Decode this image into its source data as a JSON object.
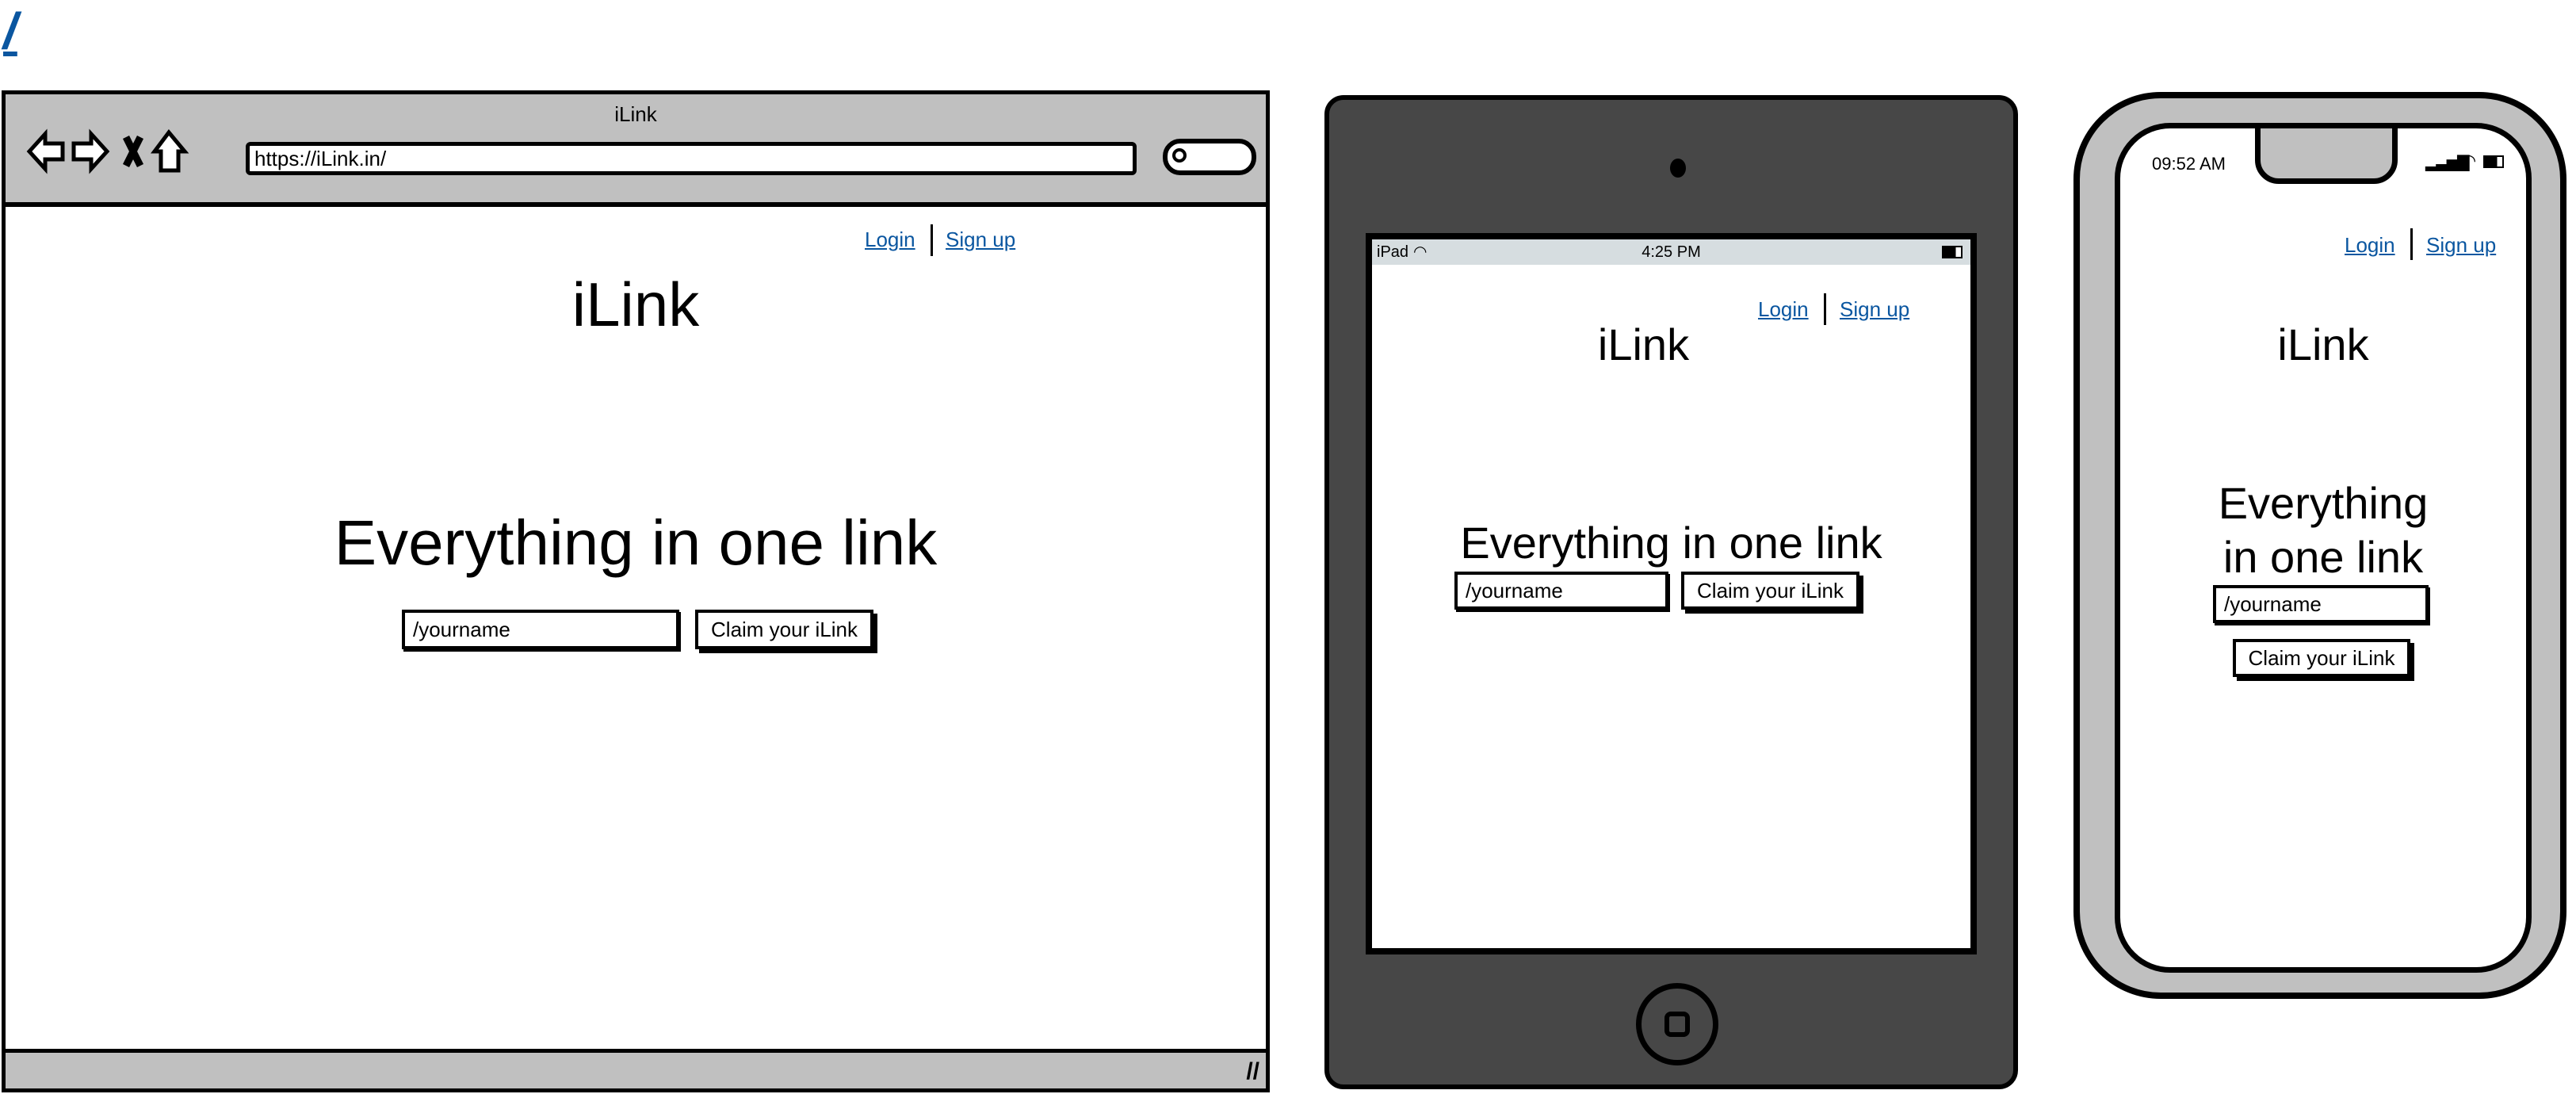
{
  "page_link": "/",
  "colors": {
    "link": "#0a56a0",
    "browser_chrome": "#c0c0c0",
    "ipad_body": "#474747",
    "ipad_statusbar": "#d6dde0",
    "iphone_body": "#c0c0c0"
  },
  "browser": {
    "window_title": "iLink",
    "url": "https://iLink.in/",
    "nav_icons": [
      "back-arrow-icon",
      "forward-arrow-icon",
      "close-x-icon",
      "home-icon"
    ],
    "search_icon": "search-icon"
  },
  "ipad": {
    "status_left": "iPad",
    "status_time": "4:25 PM"
  },
  "iphone": {
    "status_time": "09:52 AM"
  },
  "site": {
    "login": "Login",
    "signup": "Sign up",
    "logo": "iLink",
    "headline": "Everything in one link",
    "headline_line1": "Everything",
    "headline_line2": "in one link",
    "username_placeholder": "/yourname",
    "claim_button": "Claim your iLink"
  }
}
